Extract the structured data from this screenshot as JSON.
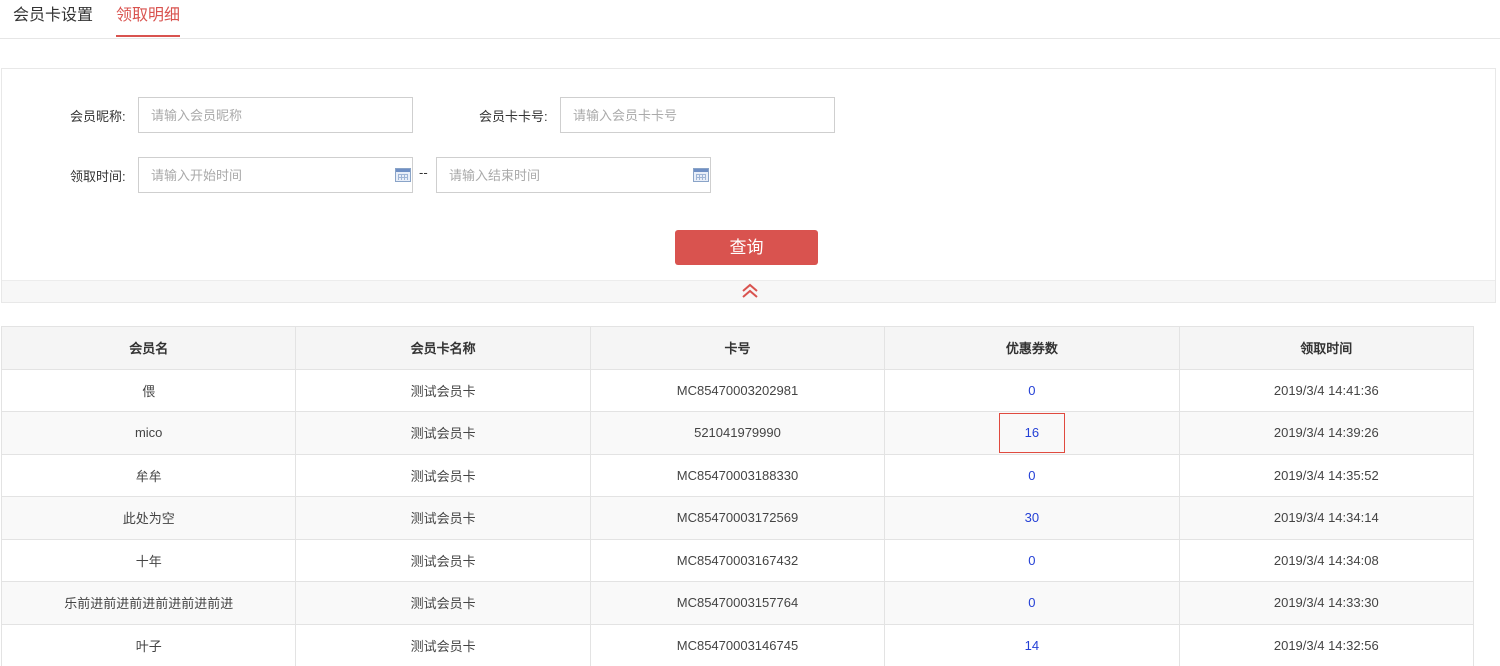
{
  "tabs": [
    {
      "label": "会员卡设置"
    },
    {
      "label": "领取明细"
    }
  ],
  "filter": {
    "nickname_label": "会员昵称:",
    "nickname_placeholder": "请输入会员昵称",
    "cardno_label": "会员卡卡号:",
    "cardno_placeholder": "请输入会员卡卡号",
    "time_label": "领取时间:",
    "start_placeholder": "请输入开始时间",
    "separator": "--",
    "end_placeholder": "请输入结束时间",
    "query_label": "查询"
  },
  "table": {
    "headers": [
      "会员名",
      "会员卡名称",
      "卡号",
      "优惠券数",
      "领取时间"
    ],
    "rows": [
      [
        "偎",
        "测试会员卡",
        "MC85470003202981",
        "0",
        "2019/3/4 14:41:36"
      ],
      [
        "mico",
        "测试会员卡",
        "521041979990",
        "16",
        "2019/3/4 14:39:26"
      ],
      [
        "牟牟",
        "测试会员卡",
        "MC85470003188330",
        "0",
        "2019/3/4 14:35:52"
      ],
      [
        "此处为空",
        "测试会员卡",
        "MC85470003172569",
        "30",
        "2019/3/4 14:34:14"
      ],
      [
        "十年",
        "测试会员卡",
        "MC85470003167432",
        "0",
        "2019/3/4 14:34:08"
      ],
      [
        "乐前进前进前进前进前进前进",
        "测试会员卡",
        "MC85470003157764",
        "0",
        "2019/3/4 14:33:30"
      ],
      [
        "叶子",
        "测试会员卡",
        "MC85470003146745",
        "14",
        "2019/3/4 14:32:56"
      ]
    ]
  },
  "colors": {
    "accent": "#d9534f",
    "link_number": "#2440d6",
    "highlight_border": "#e04a3f"
  },
  "icons": [
    "calendar-icon",
    "chevron-double-up-icon"
  ]
}
